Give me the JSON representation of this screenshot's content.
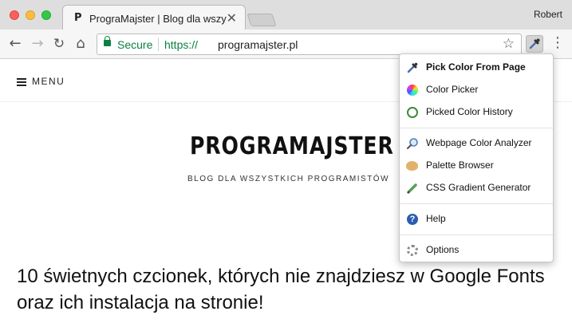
{
  "window": {
    "profile_name": "Robert"
  },
  "tab": {
    "favicon_letter": "P",
    "title": "PrograMajster | Blog dla wszystkich programistów",
    "close_glyph": "✕"
  },
  "toolbar": {
    "back_glyph": "←",
    "forward_glyph": "→",
    "reload_glyph": "↻",
    "home_glyph": "⌂",
    "secure_label": "Secure",
    "url_protocol": "https://",
    "url_host": "programajster.pl",
    "star_glyph": "☆",
    "menu_glyph": "⋮"
  },
  "page": {
    "menu_label": "MENU",
    "logo": "PROGRAMAJSTER",
    "tagline": "BLOG DLA WSZYSTKICH PROGRAMISTÓW",
    "post_title": "10 świetnych czcionek, których nie znajdziesz w Google Fonts oraz ich instalacja na stronie!"
  },
  "dropdown": {
    "items": [
      {
        "label": "Pick Color From Page",
        "icon": "eyedropper-icon"
      },
      {
        "label": "Color Picker",
        "icon": "color-wheel-icon"
      },
      {
        "label": "Picked Color History",
        "icon": "history-icon"
      },
      {
        "label": "Webpage Color Analyzer",
        "icon": "magnifier-icon"
      },
      {
        "label": "Palette Browser",
        "icon": "palette-icon"
      },
      {
        "label": "CSS Gradient Generator",
        "icon": "gradient-pen-icon"
      },
      {
        "label": "Help",
        "icon": "help-icon",
        "glyph": "?"
      },
      {
        "label": "Options",
        "icon": "gear-icon"
      }
    ]
  },
  "colors": {
    "secure_green": "#0b8043",
    "window_chrome": "#dedede",
    "toolbar": "#f6f6f6"
  }
}
